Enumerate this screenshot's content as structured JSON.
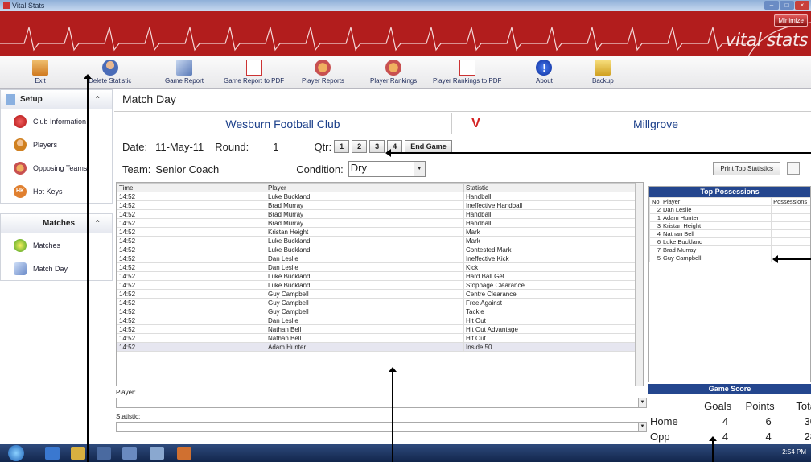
{
  "window": {
    "title": "Vital Stats",
    "minimize_label": "Minimize",
    "logo": "vital stats"
  },
  "toolbar": [
    {
      "label": "Exit",
      "icon": "exit-icon"
    },
    {
      "label": "Delete Statistic",
      "icon": "delete-user-icon"
    },
    {
      "label": "Game Report",
      "icon": "report-icon"
    },
    {
      "label": "Game Report to PDF",
      "icon": "pdf-icon"
    },
    {
      "label": "Player Reports",
      "icon": "players-icon"
    },
    {
      "label": "Player Rankings",
      "icon": "rankings-icon"
    },
    {
      "label": "Player Rankings to PDF",
      "icon": "pdf-icon"
    },
    {
      "label": "About",
      "icon": "info-icon"
    },
    {
      "label": "Backup",
      "icon": "backup-icon"
    }
  ],
  "sidebar": {
    "setup_title": "Setup",
    "setup_items": [
      {
        "label": "Club Information",
        "icon": "club-icon"
      },
      {
        "label": "Players",
        "icon": "player-icon"
      },
      {
        "label": "Opposing Teams",
        "icon": "teams-icon"
      },
      {
        "label": "Hot Keys",
        "icon": "hotkeys-icon"
      }
    ],
    "matches_title": "Matches",
    "matches_items": [
      {
        "label": "Matches",
        "icon": "clock-icon"
      },
      {
        "label": "Match Day",
        "icon": "matchday-icon"
      }
    ]
  },
  "main": {
    "title": "Match Day",
    "home_team": "Wesburn Football Club",
    "vs": "V",
    "away_team": "Millgrove",
    "date_label": "Date:",
    "date": "11-May-11",
    "round_label": "Round:",
    "round": "1",
    "qtr_label": "Qtr:",
    "qtr_buttons": [
      "1",
      "2",
      "3",
      "4",
      "End Game"
    ],
    "team_label": "Team:",
    "team": "Senior Coach",
    "condition_label": "Condition:",
    "condition": "Dry",
    "print_top": "Print Top Statistics"
  },
  "grid": {
    "headers": [
      "Time",
      "Player",
      "Statistic"
    ],
    "rows": [
      [
        "14:52",
        "Luke Buckland",
        "Handball"
      ],
      [
        "14:52",
        "Brad Murray",
        "Ineffective Handball"
      ],
      [
        "14:52",
        "Brad Murray",
        "Handball"
      ],
      [
        "14:52",
        "Brad Murray",
        "Handball"
      ],
      [
        "14:52",
        "Kristan Height",
        "Mark"
      ],
      [
        "14:52",
        "Luke Buckland",
        "Mark"
      ],
      [
        "14:52",
        "Luke Buckland",
        "Contested Mark"
      ],
      [
        "14:52",
        "Dan Leslie",
        "Ineffective Kick"
      ],
      [
        "14:52",
        "Dan Leslie",
        "Kick"
      ],
      [
        "14:52",
        "Luke Buckland",
        "Hard Ball Get"
      ],
      [
        "14:52",
        "Luke Buckland",
        "Stoppage Clearance"
      ],
      [
        "14:52",
        "Guy Campbell",
        "Centre Clearance"
      ],
      [
        "14:52",
        "Guy Campbell",
        "Free Against"
      ],
      [
        "14:52",
        "Guy Campbell",
        "Tackle"
      ],
      [
        "14:52",
        "Dan Leslie",
        "Hit Out"
      ],
      [
        "14:52",
        "Nathan Bell",
        "Hit Out Advantage"
      ],
      [
        "14:52",
        "Nathan Bell",
        "Hit Out"
      ],
      [
        "14:52",
        "Adam Hunter",
        "Inside 50"
      ]
    ]
  },
  "fields": {
    "player_label": "Player:",
    "statistic_label": "Statistic:"
  },
  "top_possessions": {
    "title": "Top Possessions",
    "headers": [
      "No",
      "Player",
      "Possessions"
    ],
    "rows": [
      [
        "2",
        "Dan Leslie"
      ],
      [
        "1",
        "Adam Hunter"
      ],
      [
        "3",
        "Kristan Height"
      ],
      [
        "4",
        "Nathan Bell"
      ],
      [
        "6",
        "Luke Buckland"
      ],
      [
        "7",
        "Brad Murray"
      ],
      [
        "5",
        "Guy Campbell"
      ]
    ]
  },
  "game_score": {
    "title": "Game Score",
    "headers": [
      "",
      "Goals",
      "Points",
      "Tota"
    ],
    "rows": [
      [
        "Home",
        "4",
        "6",
        "30"
      ],
      [
        "Opp",
        "4",
        "4",
        "28"
      ]
    ]
  },
  "taskbar": {
    "clock": "2:54 PM"
  }
}
